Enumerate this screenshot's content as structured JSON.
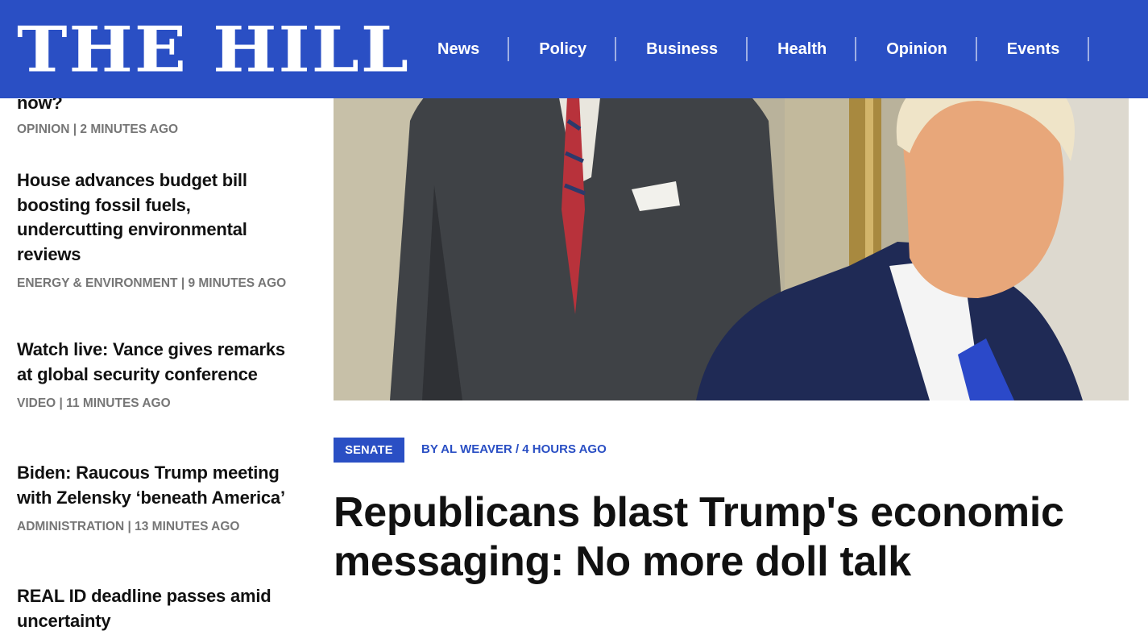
{
  "header": {
    "logo_text": "THE HILL",
    "nav": [
      "News",
      "Policy",
      "Business",
      "Health",
      "Opinion",
      "Events"
    ]
  },
  "sidebar": {
    "stories": [
      {
        "title": "now?",
        "meta": "OPINION | 2 MINUTES AGO"
      },
      {
        "title": "House advances budget bill boosting fossil fuels, undercutting environmental reviews",
        "meta": "ENERGY & ENVIRONMENT | 9 MINUTES AGO"
      },
      {
        "title": "Watch live: Vance gives remarks at global security conference",
        "meta": "VIDEO | 11 MINUTES AGO"
      },
      {
        "title": "Biden: Raucous Trump meeting with Zelensky ‘beneath America’",
        "meta": "ADMINISTRATION | 13 MINUTES AGO"
      },
      {
        "title": "REAL ID deadline passes amid uncertainty",
        "meta": ""
      }
    ]
  },
  "article": {
    "tag": "SENATE",
    "byline": "BY AL WEAVER / 4 HOURS AGO",
    "headline": "Republicans blast Trump's economic messaging: No more doll talk"
  },
  "colors": {
    "brand_blue": "#2a4fc4",
    "meta_gray": "#767676"
  }
}
